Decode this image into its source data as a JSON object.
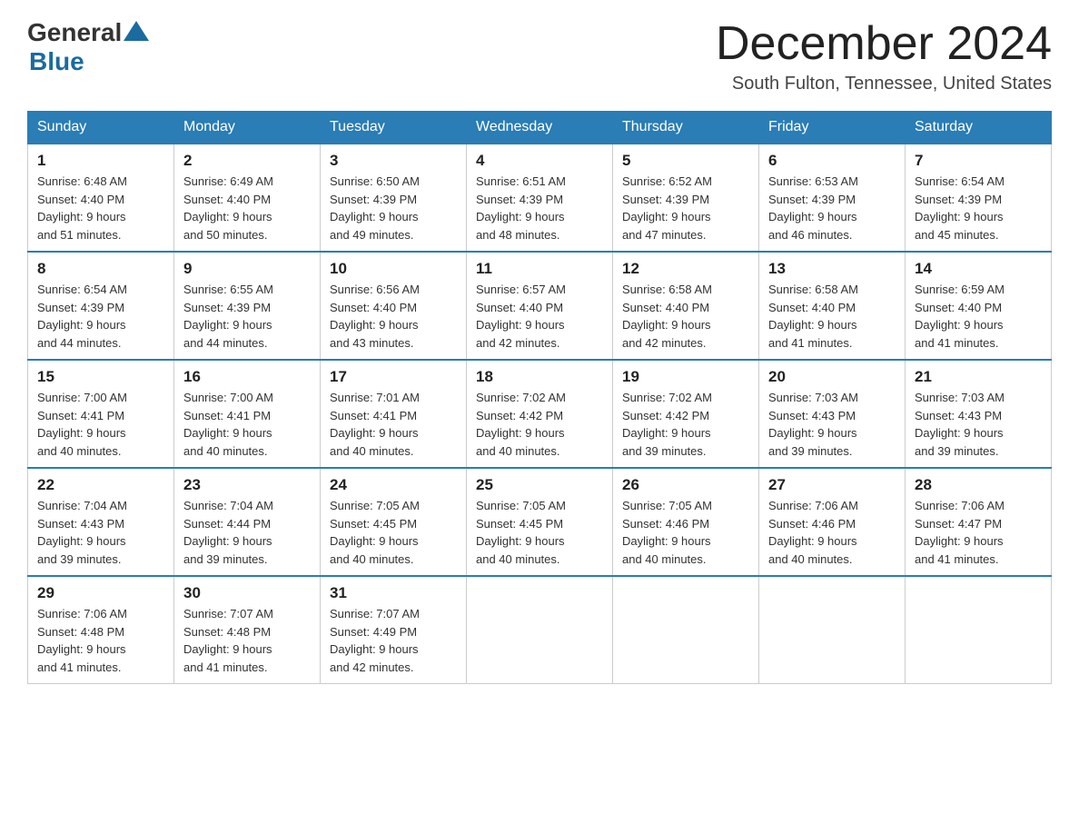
{
  "header": {
    "logo_general": "General",
    "logo_blue": "Blue",
    "calendar_title": "December 2024",
    "calendar_subtitle": "South Fulton, Tennessee, United States"
  },
  "days_of_week": [
    "Sunday",
    "Monday",
    "Tuesday",
    "Wednesday",
    "Thursday",
    "Friday",
    "Saturday"
  ],
  "weeks": [
    [
      {
        "day": "1",
        "sunrise": "6:48 AM",
        "sunset": "4:40 PM",
        "daylight": "9 hours and 51 minutes."
      },
      {
        "day": "2",
        "sunrise": "6:49 AM",
        "sunset": "4:40 PM",
        "daylight": "9 hours and 50 minutes."
      },
      {
        "day": "3",
        "sunrise": "6:50 AM",
        "sunset": "4:39 PM",
        "daylight": "9 hours and 49 minutes."
      },
      {
        "day": "4",
        "sunrise": "6:51 AM",
        "sunset": "4:39 PM",
        "daylight": "9 hours and 48 minutes."
      },
      {
        "day": "5",
        "sunrise": "6:52 AM",
        "sunset": "4:39 PM",
        "daylight": "9 hours and 47 minutes."
      },
      {
        "day": "6",
        "sunrise": "6:53 AM",
        "sunset": "4:39 PM",
        "daylight": "9 hours and 46 minutes."
      },
      {
        "day": "7",
        "sunrise": "6:54 AM",
        "sunset": "4:39 PM",
        "daylight": "9 hours and 45 minutes."
      }
    ],
    [
      {
        "day": "8",
        "sunrise": "6:54 AM",
        "sunset": "4:39 PM",
        "daylight": "9 hours and 44 minutes."
      },
      {
        "day": "9",
        "sunrise": "6:55 AM",
        "sunset": "4:39 PM",
        "daylight": "9 hours and 44 minutes."
      },
      {
        "day": "10",
        "sunrise": "6:56 AM",
        "sunset": "4:40 PM",
        "daylight": "9 hours and 43 minutes."
      },
      {
        "day": "11",
        "sunrise": "6:57 AM",
        "sunset": "4:40 PM",
        "daylight": "9 hours and 42 minutes."
      },
      {
        "day": "12",
        "sunrise": "6:58 AM",
        "sunset": "4:40 PM",
        "daylight": "9 hours and 42 minutes."
      },
      {
        "day": "13",
        "sunrise": "6:58 AM",
        "sunset": "4:40 PM",
        "daylight": "9 hours and 41 minutes."
      },
      {
        "day": "14",
        "sunrise": "6:59 AM",
        "sunset": "4:40 PM",
        "daylight": "9 hours and 41 minutes."
      }
    ],
    [
      {
        "day": "15",
        "sunrise": "7:00 AM",
        "sunset": "4:41 PM",
        "daylight": "9 hours and 40 minutes."
      },
      {
        "day": "16",
        "sunrise": "7:00 AM",
        "sunset": "4:41 PM",
        "daylight": "9 hours and 40 minutes."
      },
      {
        "day": "17",
        "sunrise": "7:01 AM",
        "sunset": "4:41 PM",
        "daylight": "9 hours and 40 minutes."
      },
      {
        "day": "18",
        "sunrise": "7:02 AM",
        "sunset": "4:42 PM",
        "daylight": "9 hours and 40 minutes."
      },
      {
        "day": "19",
        "sunrise": "7:02 AM",
        "sunset": "4:42 PM",
        "daylight": "9 hours and 39 minutes."
      },
      {
        "day": "20",
        "sunrise": "7:03 AM",
        "sunset": "4:43 PM",
        "daylight": "9 hours and 39 minutes."
      },
      {
        "day": "21",
        "sunrise": "7:03 AM",
        "sunset": "4:43 PM",
        "daylight": "9 hours and 39 minutes."
      }
    ],
    [
      {
        "day": "22",
        "sunrise": "7:04 AM",
        "sunset": "4:43 PM",
        "daylight": "9 hours and 39 minutes."
      },
      {
        "day": "23",
        "sunrise": "7:04 AM",
        "sunset": "4:44 PM",
        "daylight": "9 hours and 39 minutes."
      },
      {
        "day": "24",
        "sunrise": "7:05 AM",
        "sunset": "4:45 PM",
        "daylight": "9 hours and 40 minutes."
      },
      {
        "day": "25",
        "sunrise": "7:05 AM",
        "sunset": "4:45 PM",
        "daylight": "9 hours and 40 minutes."
      },
      {
        "day": "26",
        "sunrise": "7:05 AM",
        "sunset": "4:46 PM",
        "daylight": "9 hours and 40 minutes."
      },
      {
        "day": "27",
        "sunrise": "7:06 AM",
        "sunset": "4:46 PM",
        "daylight": "9 hours and 40 minutes."
      },
      {
        "day": "28",
        "sunrise": "7:06 AM",
        "sunset": "4:47 PM",
        "daylight": "9 hours and 41 minutes."
      }
    ],
    [
      {
        "day": "29",
        "sunrise": "7:06 AM",
        "sunset": "4:48 PM",
        "daylight": "9 hours and 41 minutes."
      },
      {
        "day": "30",
        "sunrise": "7:07 AM",
        "sunset": "4:48 PM",
        "daylight": "9 hours and 41 minutes."
      },
      {
        "day": "31",
        "sunrise": "7:07 AM",
        "sunset": "4:49 PM",
        "daylight": "9 hours and 42 minutes."
      },
      null,
      null,
      null,
      null
    ]
  ]
}
